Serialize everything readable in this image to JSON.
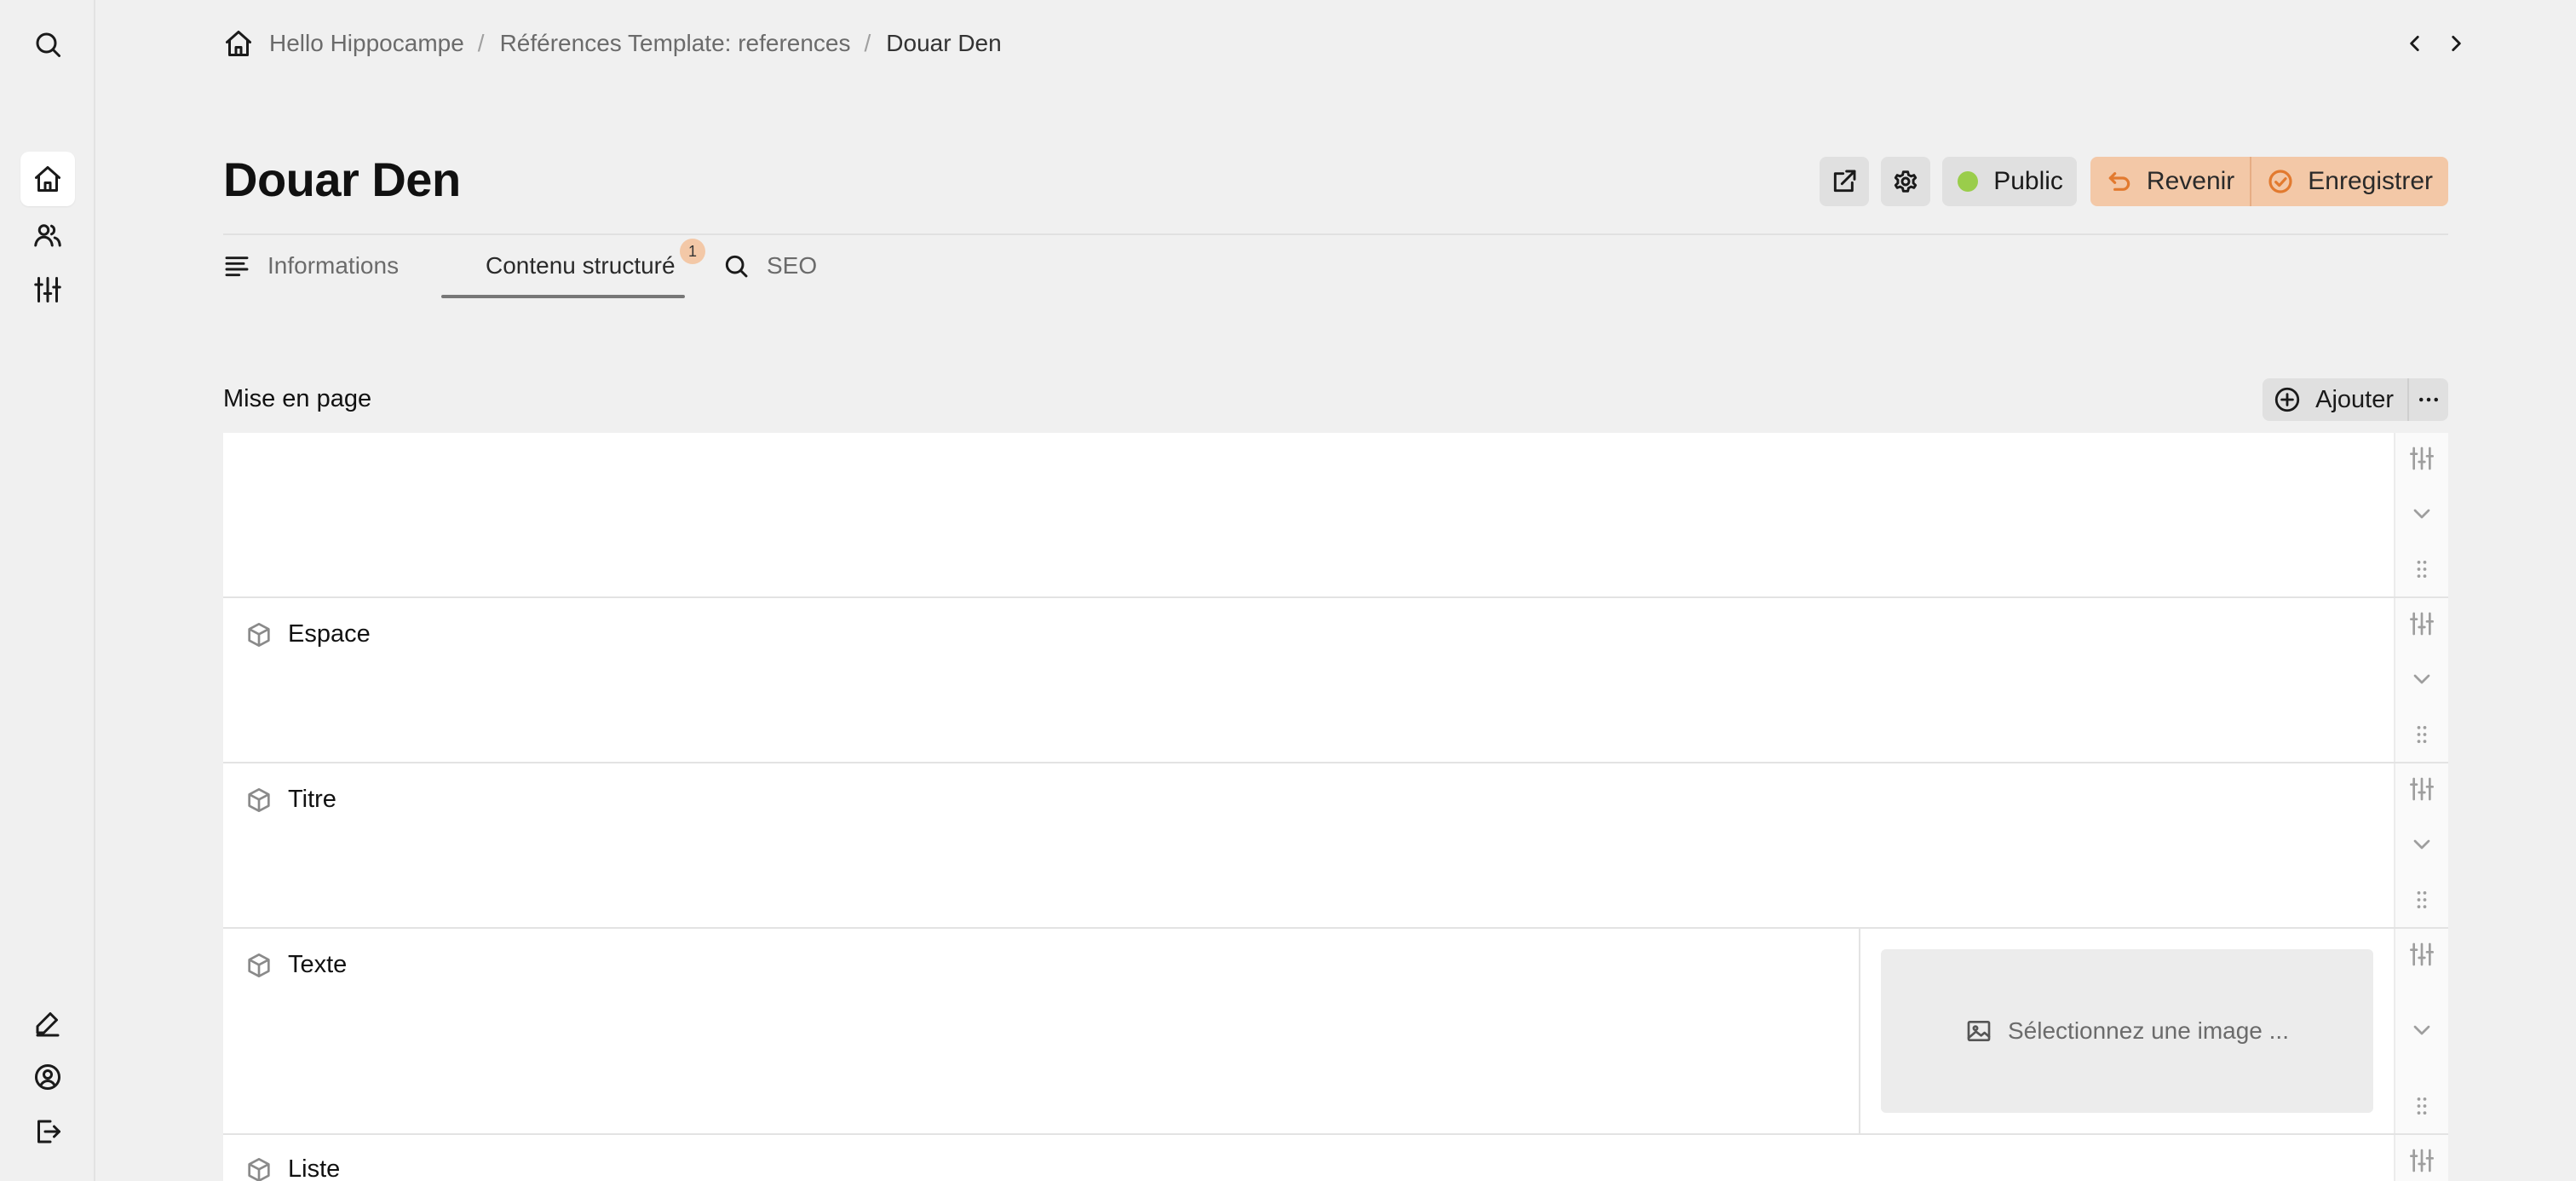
{
  "breadcrumb": {
    "home_icon": "home-icon",
    "items": [
      "Hello Hippocampe",
      "Références Template: references",
      "Douar Den"
    ],
    "separator": "/"
  },
  "page": {
    "title": "Douar Den"
  },
  "actions": {
    "external_link_icon": "external-link-icon",
    "settings_icon": "gear-icon",
    "visibility_label": "Public",
    "visibility_color": "#9acd4b",
    "revert_label": "Revenir",
    "save_label": "Enregistrer",
    "accent_color": "#f3c8a7"
  },
  "tabs": [
    {
      "label": "Informations",
      "icon": "text-lines-icon"
    },
    {
      "label": "Contenu structuré",
      "badge": "1"
    },
    {
      "label": "SEO",
      "icon": "search-icon"
    }
  ],
  "section": {
    "title": "Mise en page",
    "add_label": "Ajouter",
    "more_icon": "ellipsis-icon"
  },
  "blocks": [
    {
      "label": ""
    },
    {
      "label": "Espace",
      "icon": "cube-icon"
    },
    {
      "label": "Titre",
      "icon": "cube-icon"
    },
    {
      "label": "Texte",
      "icon": "cube-icon",
      "image_placeholder": "Sélectionnez une image ..."
    },
    {
      "label": "Liste",
      "icon": "cube-icon"
    }
  ],
  "sidebar": {
    "top": [
      "search-icon",
      "home-icon",
      "users-icon",
      "sliders-icon"
    ],
    "bottom": [
      "edit-icon",
      "user-circle-icon",
      "logout-icon"
    ]
  }
}
